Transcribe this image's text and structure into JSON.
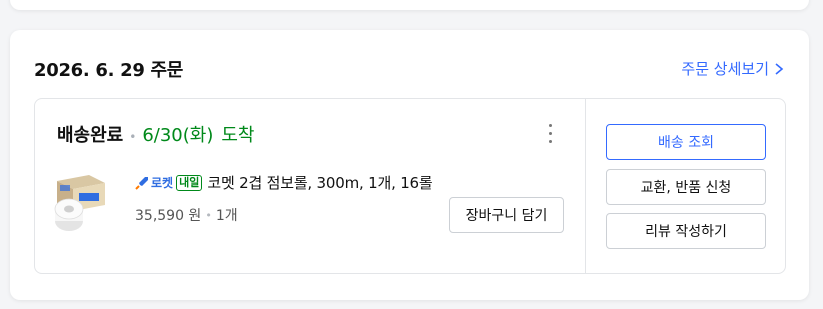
{
  "order": {
    "date": "2026. 6. 29 주문",
    "detail_link": "주문 상세보기"
  },
  "shipment": {
    "status": "배송완료",
    "arrival_date": "6/30(화)",
    "arrival_word": "도착"
  },
  "product": {
    "badge_rocket": "로켓",
    "badge_naeil": "내일",
    "name": "코멧 2겹 점보롤, 300m, 1개, 16롤",
    "price": "35,590 원",
    "quantity": "1개",
    "image_icon": "toilet-paper-product-image",
    "cart_button": "장바구니 담기"
  },
  "actions": {
    "track": "배송 조회",
    "exchange": "교환, 반품 신청",
    "review": "리뷰 작성하기"
  },
  "colors": {
    "accent": "#346aff",
    "arrival_green": "#00891a"
  }
}
